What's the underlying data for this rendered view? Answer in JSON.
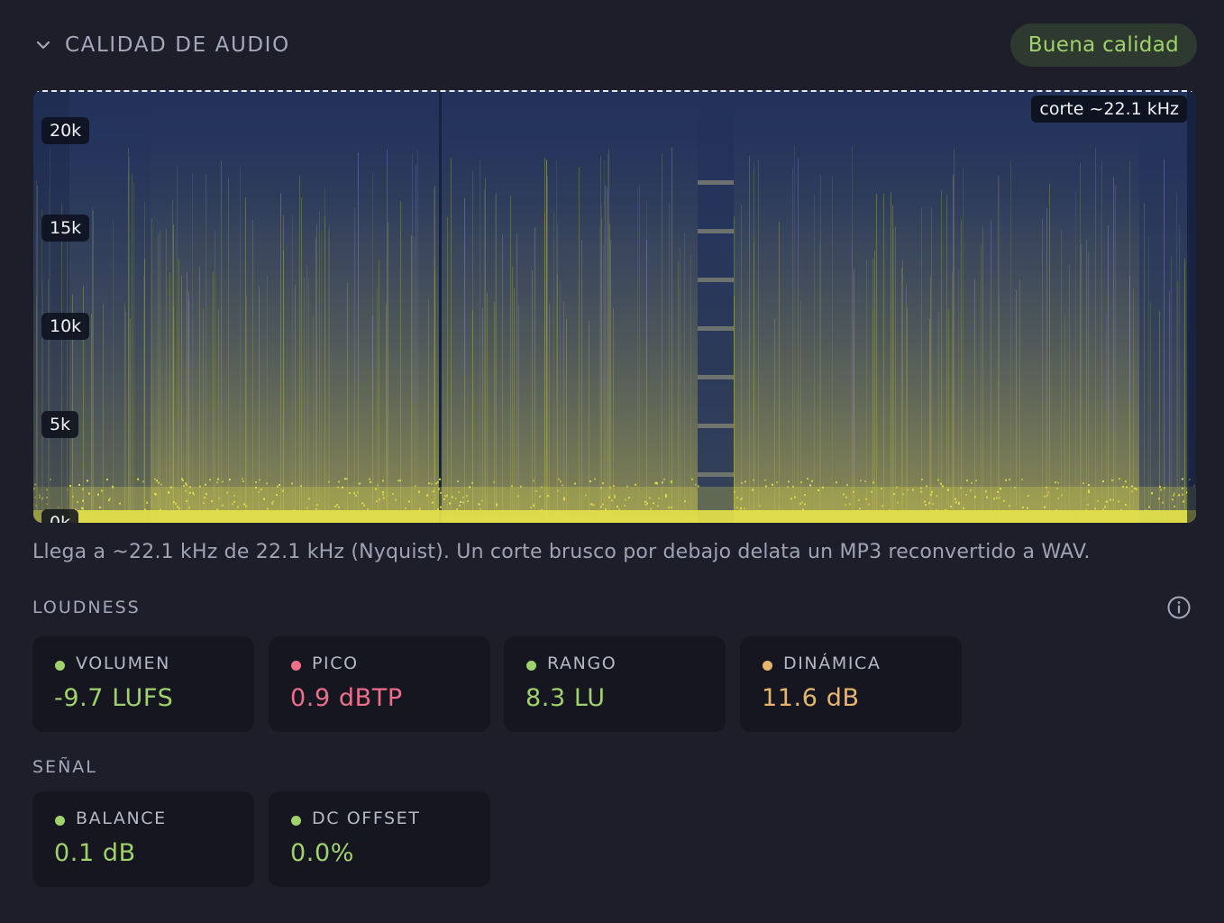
{
  "header": {
    "title": "CALIDAD DE AUDIO",
    "quality_badge": "Buena calidad",
    "collapse_icon": "chevron-down-icon"
  },
  "spectrogram": {
    "cutoff_label": "corte ~22.1 kHz",
    "freq_labels": [
      "20k",
      "15k",
      "10k",
      "5k",
      "0k"
    ],
    "colors": {
      "low": "#23325a",
      "high": "#e6e24a",
      "cutoff_line": "#e6e8f0"
    }
  },
  "note": "Llega a ~22.1 kHz de 22.1 kHz (Nyquist). Un corte brusco por debajo delata un MP3 reconvertido a WAV.",
  "loudness": {
    "title": "LOUDNESS",
    "info_icon": "info-icon",
    "cards": [
      {
        "label": "VOLUMEN",
        "value": "-9.7 LUFS",
        "color": "#9fd26b"
      },
      {
        "label": "PICO",
        "value": "0.9 dBTP",
        "color": "#ee6f8a"
      },
      {
        "label": "RANGO",
        "value": "8.3 LU",
        "color": "#9fd26b"
      },
      {
        "label": "DINÁMICA",
        "value": "11.6 dB",
        "color": "#e8b66a"
      }
    ]
  },
  "signal": {
    "title": "SEÑAL",
    "cards": [
      {
        "label": "BALANCE",
        "value": "0.1 dB",
        "color": "#9fd26b"
      },
      {
        "label": "DC OFFSET",
        "value": "0.0%",
        "color": "#9fd26b"
      }
    ]
  }
}
